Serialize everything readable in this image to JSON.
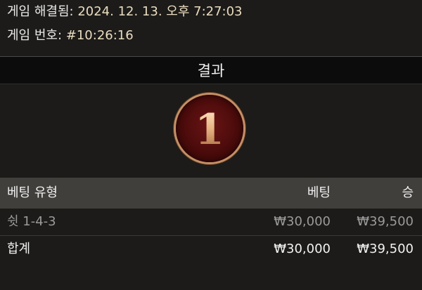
{
  "info": {
    "resolved_label": "게임 해결됨:",
    "resolved_value": "2024. 12. 13. 오후 7:27:03",
    "game_no_label": "게임 번호:",
    "game_no_value": "#10:26:16"
  },
  "result": {
    "title": "결과",
    "number": "1"
  },
  "table": {
    "headers": {
      "type": "베팅 유형",
      "bet": "베팅",
      "win": "승"
    },
    "rows": [
      {
        "type": "쉿 1-4-3",
        "bet": "₩30,000",
        "win": "₩39,500"
      }
    ],
    "total": {
      "label": "합계",
      "bet": "₩30,000",
      "win": "₩39,500"
    }
  },
  "colors": {
    "background": "#1c1b19",
    "header_bar": "#403f3c",
    "ball": "#480a0a",
    "ball_ring": "#c59067",
    "value_text": "#e9dcc0"
  }
}
